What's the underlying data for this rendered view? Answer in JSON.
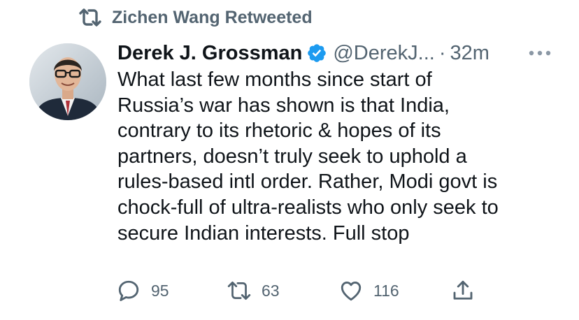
{
  "retweet_banner": {
    "icon": "retweet-icon",
    "text": "Zichen Wang Retweeted"
  },
  "tweet": {
    "display_name": "Derek J. Grossman",
    "verified_icon": "verified-badge-icon",
    "handle": "@DerekJ...",
    "separator": "·",
    "time": "32m",
    "more_icon": "more-dots-icon",
    "text": "What last few months since start of\nRussia’s war has shown is that India,\ncontrary to its rhetoric & hopes of its\npartners, doesn’t truly seek to uphold a\nrules-based intl order. Rather, Modi govt is\nchock-full of ultra-realists who only seek to\nsecure Indian interests. Full stop"
  },
  "actions": {
    "reply": {
      "icon": "reply-icon",
      "count": "95"
    },
    "retweet": {
      "icon": "retweet-icon",
      "count": "63"
    },
    "like": {
      "icon": "like-heart-icon",
      "count": "116"
    },
    "share": {
      "icon": "share-icon"
    }
  },
  "colors": {
    "text": "#0f1419",
    "secondary": "#536471",
    "verified": "#1d9bf0"
  }
}
